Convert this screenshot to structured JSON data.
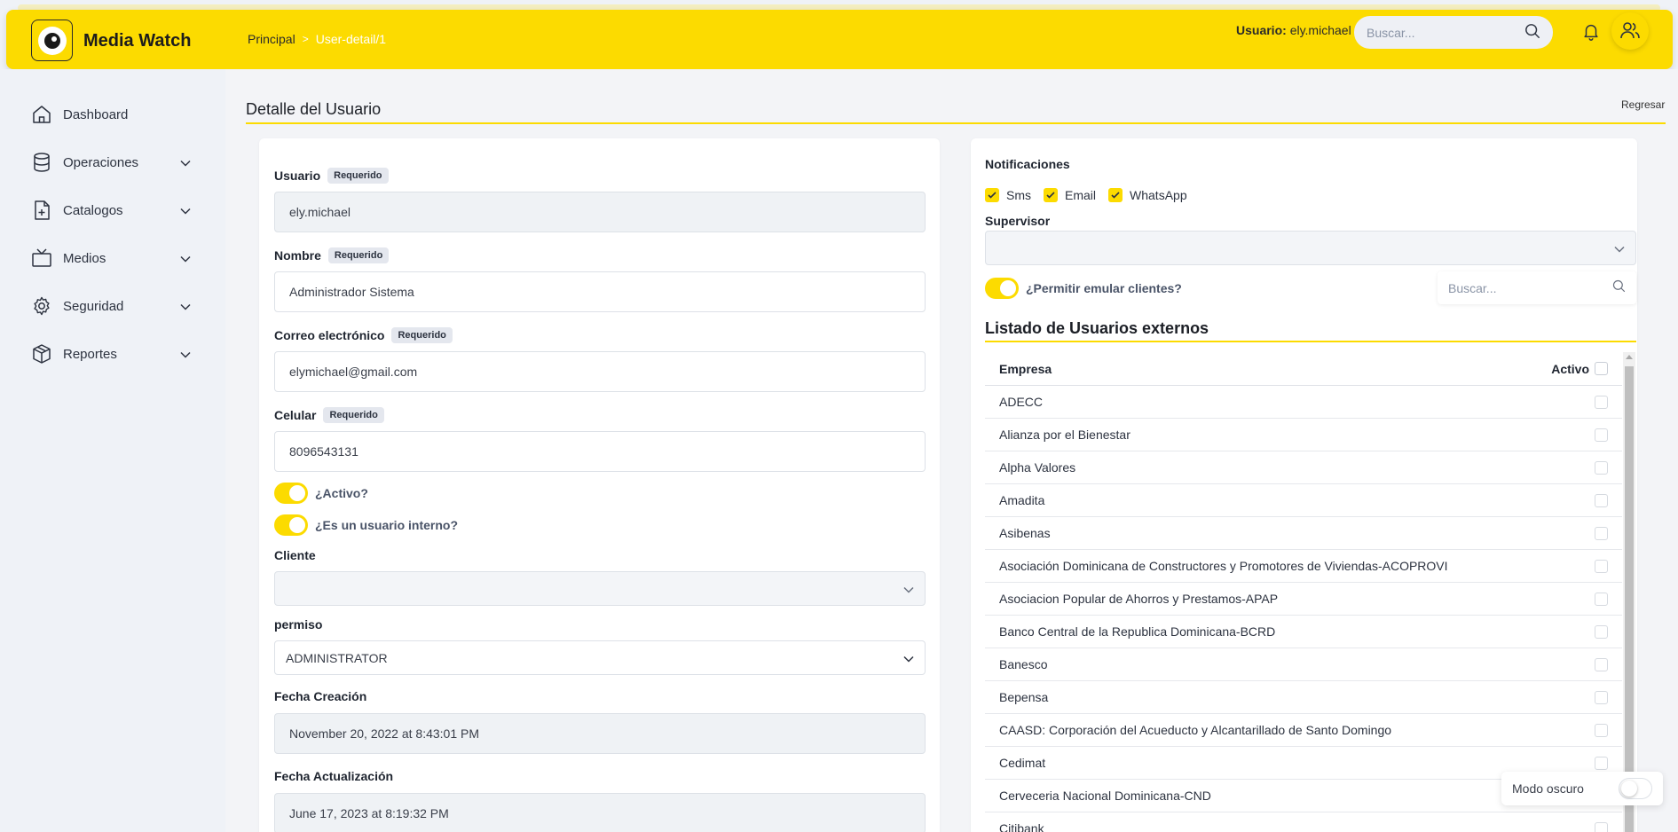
{
  "header": {
    "app_title": "Media Watch",
    "breadcrumb": {
      "home": "Principal",
      "separator": ">",
      "current": "User-detail/1"
    },
    "user_label": "Usuario:",
    "user_name": "ely.michael",
    "search_placeholder": "Buscar..."
  },
  "sidebar": {
    "items": [
      {
        "label": "Dashboard",
        "icon": "home-icon"
      },
      {
        "label": "Operaciones",
        "icon": "database-icon"
      },
      {
        "label": "Catalogos",
        "icon": "file-plus-icon"
      },
      {
        "label": "Medios",
        "icon": "tv-icon"
      },
      {
        "label": "Seguridad",
        "icon": "gear-icon"
      },
      {
        "label": "Reportes",
        "icon": "box-icon"
      }
    ]
  },
  "page": {
    "title": "Detalle del Usuario",
    "back_label": "Regresar"
  },
  "form": {
    "required_badge": "Requerido",
    "usuario_label": "Usuario",
    "usuario_value": "ely.michael",
    "nombre_label": "Nombre",
    "nombre_value": "Administrador Sistema",
    "correo_label": "Correo electrónico",
    "correo_value": "elymichael@gmail.com",
    "celular_label": "Celular",
    "celular_value": "8096543131",
    "activo_label": "¿Activo?",
    "interno_label": "¿Es un usuario interno?",
    "cliente_label": "Cliente",
    "cliente_value": "",
    "permiso_label": "permiso",
    "permiso_value": "ADMINISTRATOR",
    "fecha_creacion_label": "Fecha Creación",
    "fecha_creacion_value": "November 20, 2022 at 8:43:01 PM",
    "fecha_actualizacion_label": "Fecha Actualización",
    "fecha_actualizacion_value": "June 17, 2023 at 8:19:32 PM"
  },
  "notifications": {
    "title": "Notificaciones",
    "options": [
      "Sms",
      "Email",
      "WhatsApp"
    ],
    "supervisor_label": "Supervisor",
    "emular_label": "¿Permitir emular clientes?",
    "search_placeholder": "Buscar..."
  },
  "external_users": {
    "title": "Listado de Usuarios externos",
    "col_empresa": "Empresa",
    "col_activo": "Activo",
    "rows": [
      "ADECC",
      "Alianza por el Bienestar",
      "Alpha Valores",
      "Amadita",
      "Asibenas",
      "Asociación Dominicana de Constructores y Promotores de Viviendas-ACOPROVI",
      "Asociacion Popular de Ahorros y Prestamos-APAP",
      "Banco Central de la Republica Dominicana-BCRD",
      "Banesco",
      "Bepensa",
      "CAASD: Corporación del Acueducto y Alcantarillado de Santo Domingo",
      "Cedimat",
      "Cerveceria Nacional Dominicana-CND",
      "Citibank"
    ]
  },
  "dark_mode": {
    "label": "Modo oscuro"
  },
  "colors": {
    "accent": "#fcdb00",
    "background": "#eff2f7"
  }
}
